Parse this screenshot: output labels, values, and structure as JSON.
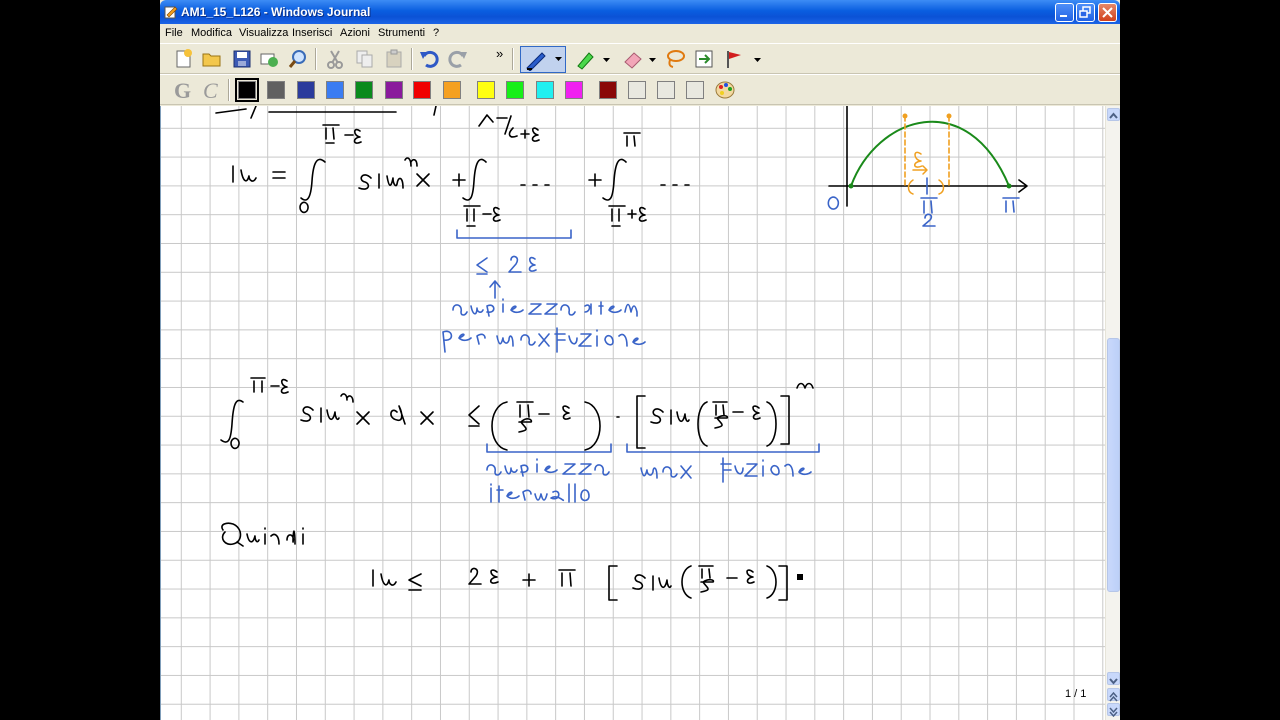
{
  "window": {
    "title": "AM1_15_L126 - Windows Journal"
  },
  "menu": [
    "File",
    "Modifica",
    "Visualizza",
    "Inserisci",
    "Azioni",
    "Strumenti",
    "?"
  ],
  "toolbar": {
    "icons": [
      "new-note-icon",
      "open-folder-icon",
      "save-icon",
      "email-icon",
      "find-icon",
      "cut-icon",
      "copy-icon",
      "paste-icon",
      "undo-icon",
      "redo-icon",
      "more-icon",
      "pen-icon",
      "highlighter-icon",
      "eraser-icon",
      "lasso-select-icon",
      "insert-space-icon",
      "flag-icon"
    ],
    "more_label": "»"
  },
  "toolbar2": {
    "format_icons": [
      "bold-g-icon",
      "italic-c-icon"
    ],
    "colors": [
      "#000000",
      "#606060",
      "#2b3b9c",
      "#3a7cf2",
      "#0a8a1c",
      "#8a1a9c",
      "#f00000",
      "#f5a020",
      "#ffff10",
      "#18ef18",
      "#20f0f0",
      "#f020f0",
      "#8a0808",
      "#e8e8e0",
      "#e8e8e0",
      "#e8e8e0"
    ],
    "palette_icon": "palette-icon"
  },
  "status": {
    "page": "1 / 1"
  },
  "ink": {
    "accent_blue": "#3a64c8",
    "accent_green": "#1a8a1a",
    "accent_orange": "#f0a020"
  }
}
